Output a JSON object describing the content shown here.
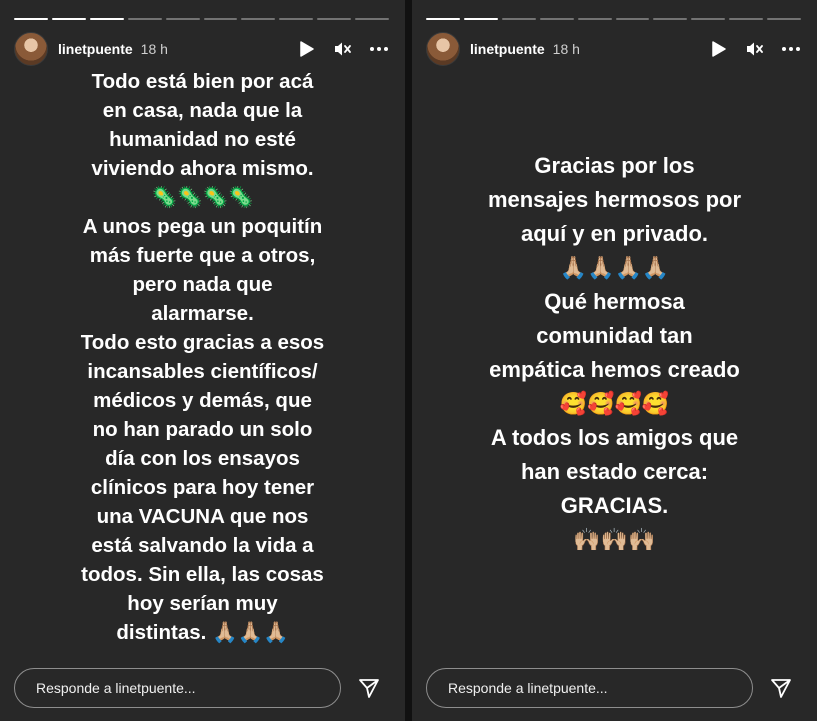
{
  "stories": [
    {
      "username": "linetpuente",
      "time": "18 h",
      "progress": [
        1,
        1,
        1,
        0,
        0,
        0,
        0,
        0,
        0,
        0
      ],
      "text": "Todo está bien por acá\nen casa, nada que la\nhumanidad no esté\nviviendo ahora mismo.\n🦠🦠🦠🦠\nA unos pega un poquitín\nmás fuerte que a otros,\npero nada que\nalarmarse.\nTodo esto gracias a esos\nincansables científicos/\nmédicos y demás, que\nno han parado un solo\ndía con los ensayos\nclínicos para hoy tener\nuna VACUNA que nos\nestá salvando la vida a\ntodos. Sin ella, las cosas\nhoy serían muy\ndistintas. 🙏🏼🙏🏼🙏🏼",
      "reply_placeholder": "Responde a linetpuente...",
      "icons": {
        "play": "play-icon",
        "mute": "muted-speaker-icon",
        "more": "more-dots-icon",
        "send": "send-arrow-icon"
      }
    },
    {
      "username": "linetpuente",
      "time": "18 h",
      "progress": [
        1,
        1,
        0,
        0,
        0,
        0,
        0,
        0,
        0,
        0
      ],
      "text": "Gracias por los\nmensajes hermosos por\naquí y en privado.\n🙏🏼🙏🏼🙏🏼🙏🏼\nQué hermosa\ncomunidad tan\nempática hemos creado\n🥰🥰🥰🥰\nA todos los amigos que\nhan estado cerca:\nGRACIAS.\n🙌🏼🙌🏼🙌🏼",
      "reply_placeholder": "Responde a linetpuente...",
      "icons": {
        "play": "play-icon",
        "mute": "muted-speaker-icon",
        "more": "more-dots-icon",
        "send": "send-arrow-icon"
      }
    }
  ],
  "colors": {
    "panel_bg": "#282828",
    "page_bg": "#1b1b1b",
    "text": "#ffffff",
    "border": "#8e8e8e"
  }
}
